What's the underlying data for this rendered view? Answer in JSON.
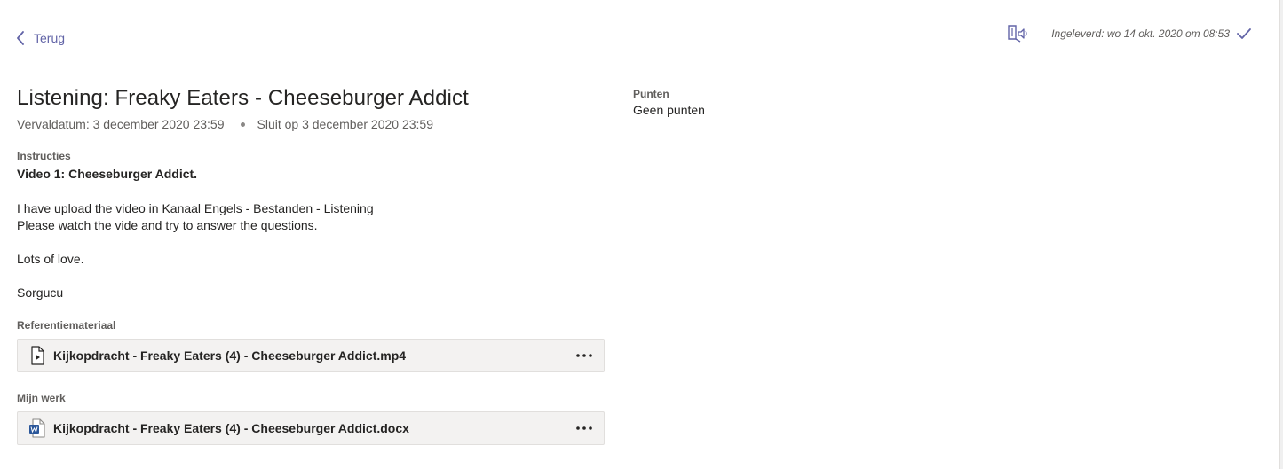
{
  "nav": {
    "back_label": "Terug"
  },
  "status": {
    "submitted_text": "Ingeleverd: wo 14 okt. 2020 om 08:53",
    "reader_icon": "immersive-reader-icon",
    "check_icon": "checkmark-icon"
  },
  "assignment": {
    "title": "Listening: Freaky Eaters - Cheeseburger Addict",
    "due_date": "Vervaldatum: 3 december 2020 23:59",
    "close_date": "Sluit op 3 december 2020 23:59"
  },
  "instructions": {
    "label": "Instructies",
    "heading": "Video 1: Cheeseburger Addict.",
    "lines": [
      "I have upload the video in Kanaal Engels - Bestanden - Listening",
      "Please watch the vide and try to answer the questions.",
      "Lots of love.",
      "Sorgucu"
    ]
  },
  "reference": {
    "label": "Referentiemateriaal",
    "file_name": "Kijkopdracht - Freaky Eaters (4) - Cheeseburger Addict.mp4",
    "file_icon": "video-file-icon"
  },
  "my_work": {
    "label": "Mijn werk",
    "file_name": "Kijkopdracht - Freaky Eaters (4) - Cheeseburger Addict.docx",
    "file_icon": "word-file-icon"
  },
  "points": {
    "label": "Punten",
    "value": "Geen punten"
  },
  "colors": {
    "accent": "#6264a7",
    "text": "#252423",
    "muted": "#605e5c",
    "card_bg": "#f3f2f1",
    "word_blue": "#2b579a"
  }
}
